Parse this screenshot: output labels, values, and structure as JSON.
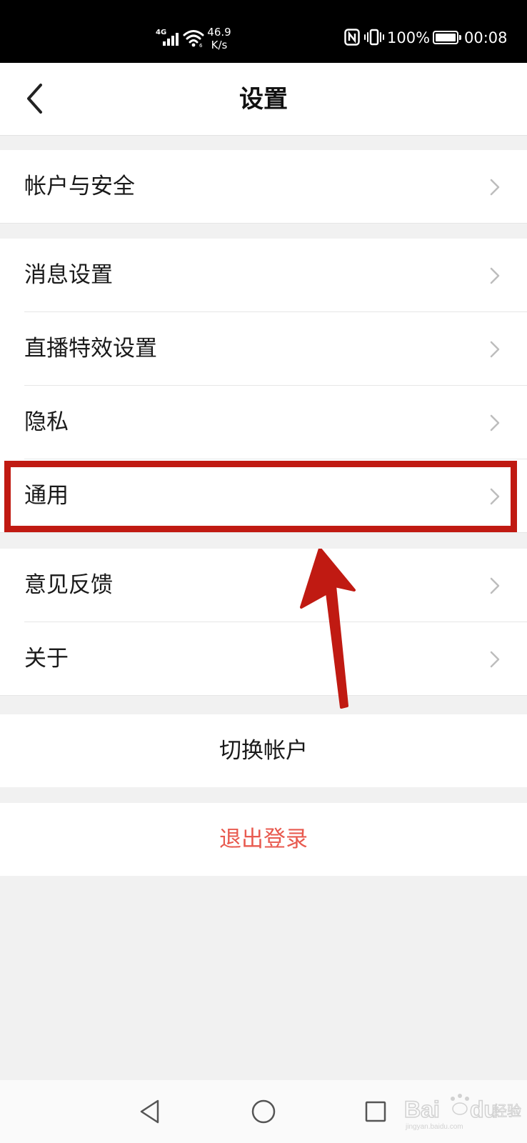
{
  "status_bar": {
    "network": "4G",
    "speed": "46.9\nK/s",
    "speed_value": "46.9",
    "speed_unit": "K/s",
    "battery": "100%",
    "battery_level": 1.0,
    "time": "00:08",
    "icons": [
      "signal-icon",
      "wifi-icon",
      "nfc-icon",
      "vibrate-icon",
      "battery-icon"
    ]
  },
  "header": {
    "title": "设置",
    "back_icon": "chevron-left-icon"
  },
  "groups": [
    {
      "items": [
        {
          "label": "帐户与安全"
        }
      ]
    },
    {
      "items": [
        {
          "label": "消息设置"
        },
        {
          "label": "直播特效设置"
        },
        {
          "label": "隐私"
        },
        {
          "label": "通用"
        }
      ]
    },
    {
      "items": [
        {
          "label": "意见反馈"
        },
        {
          "label": "关于"
        }
      ]
    }
  ],
  "actions": {
    "switch_account": "切换帐户",
    "logout": "退出登录"
  },
  "colors": {
    "logout_text": "#e85a4f",
    "annotation": "#c01a12",
    "background": "#f1f1f1"
  },
  "annotation": {
    "highlight_target": "通用",
    "arrow": "arrow-up-icon"
  },
  "navbar": {
    "buttons": [
      "back-triangle-icon",
      "home-circle-icon",
      "recents-square-icon"
    ]
  },
  "watermark": {
    "logo": "Baidu经验",
    "site": "jingyan.baidu.com"
  }
}
